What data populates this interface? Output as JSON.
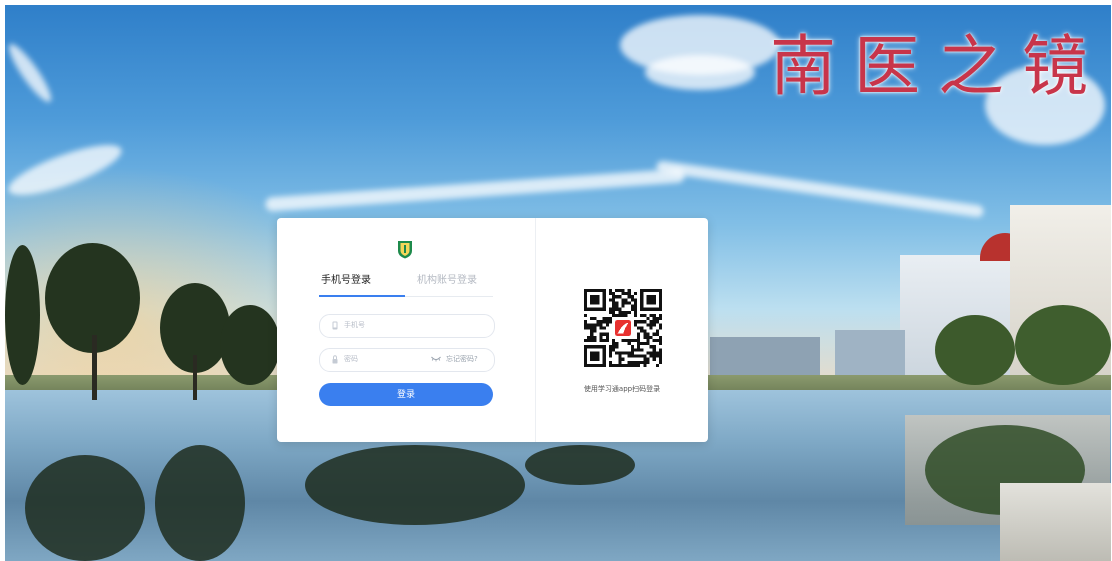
{
  "banner": {
    "calligraphy": "南医之镜"
  },
  "login": {
    "tabs": [
      {
        "label": "手机号登录",
        "active": true
      },
      {
        "label": "机构账号登录",
        "active": false
      }
    ],
    "phone": {
      "placeholder": "手机号",
      "value": ""
    },
    "password": {
      "placeholder": "密码",
      "value": ""
    },
    "forgot_label": "忘记密码?",
    "login_button": "登录"
  },
  "qr": {
    "caption": "使用学习通app扫码登录"
  },
  "colors": {
    "accent": "#3a7fef",
    "calligraphy": "#c8354a",
    "logo": "#1e8a4c"
  },
  "icons": [
    "school-logo-icon",
    "phone-icon",
    "lock-icon",
    "eye-closed-icon",
    "qr-code",
    "xuexitong-logo-icon"
  ]
}
